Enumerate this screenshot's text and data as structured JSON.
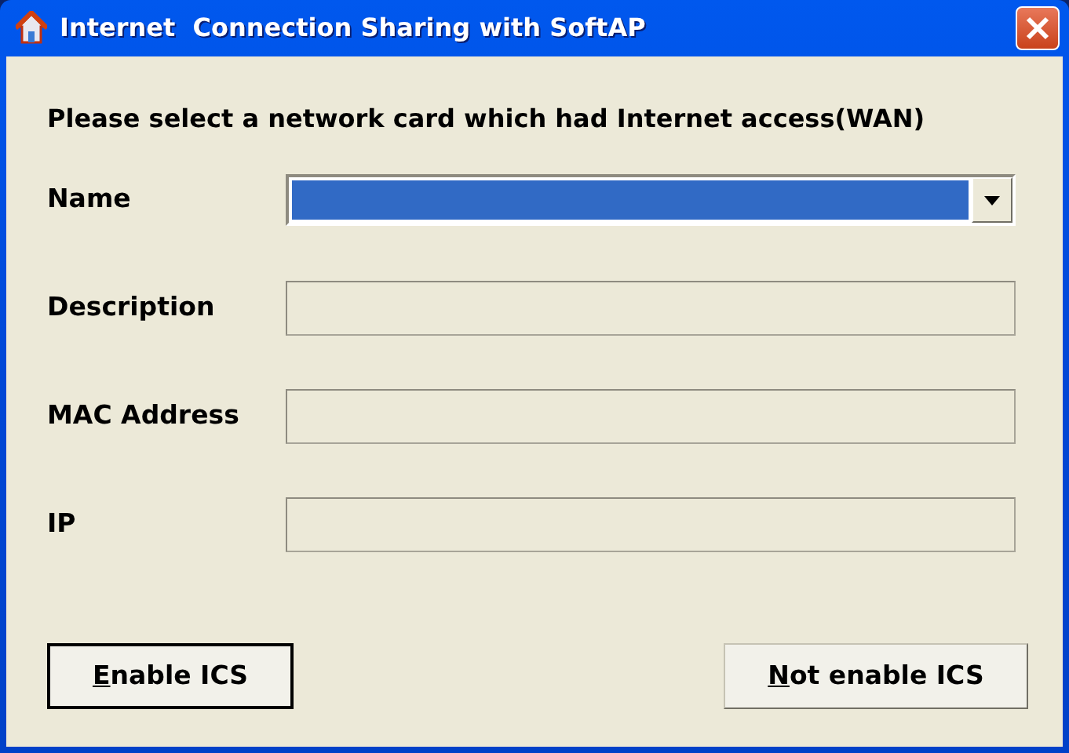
{
  "window": {
    "title": "Internet  Connection Sharing with SoftAP"
  },
  "prompt": "Please select a network card which had Internet access(WAN)",
  "fields": [
    {
      "label": "Name",
      "kind": "dropdown",
      "highlighted": true,
      "disabled": false
    },
    {
      "label": "Description",
      "kind": "text",
      "disabled": true
    },
    {
      "label": "MAC Address",
      "kind": "text",
      "disabled": true
    },
    {
      "label": "IP",
      "kind": "text",
      "disabled": true
    }
  ],
  "buttons": [
    {
      "label": "Enable ICS",
      "access_key": true,
      "default": true
    },
    {
      "label": "Not enable ICS",
      "access_key": true,
      "default": false
    }
  ]
}
